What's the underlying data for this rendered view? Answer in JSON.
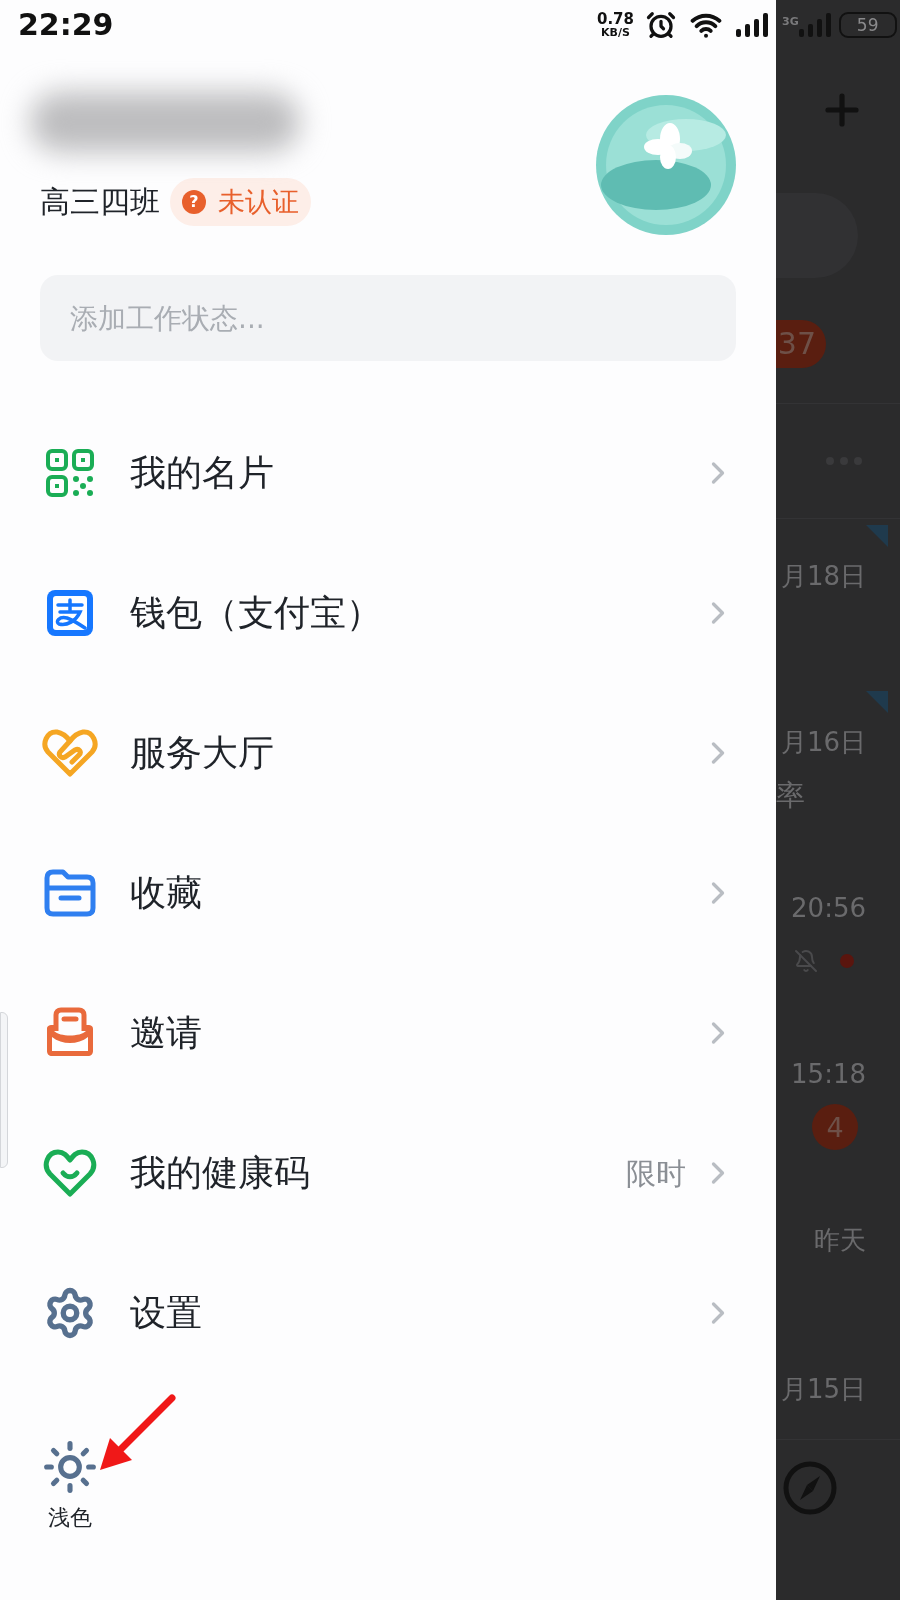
{
  "status_bar": {
    "time": "22:29",
    "net_speed": "0.78",
    "net_unit": "KB/S",
    "network": "3G",
    "battery": "59"
  },
  "profile": {
    "class_name": "高三四班",
    "badge_icon": "?",
    "badge": "未认证"
  },
  "status_field": {
    "placeholder": "添加工作状态..."
  },
  "menu": [
    {
      "kind": "qr",
      "label": "我的名片"
    },
    {
      "kind": "wallet",
      "label": "钱包（支付宝）"
    },
    {
      "kind": "service",
      "label": "服务大厅"
    },
    {
      "kind": "favorites",
      "label": "收藏"
    },
    {
      "kind": "invite",
      "label": "邀请"
    },
    {
      "kind": "health",
      "label": "我的健康码",
      "note": "限时"
    },
    {
      "kind": "settings",
      "label": "设置"
    }
  ],
  "theme_toggle": {
    "label": "浅色"
  },
  "background": {
    "unread_badge": "37",
    "rows": [
      {
        "time": "月18日",
        "flag": true
      },
      {
        "time": "月16日",
        "flag": true,
        "preview": "率"
      },
      {
        "time": "20:56",
        "flag": false,
        "muted": true,
        "dot": true
      },
      {
        "time": "15:18",
        "flag": false,
        "count": "4"
      },
      {
        "time": "昨天",
        "flag": false
      },
      {
        "time": "月15日",
        "flag": false
      }
    ]
  }
}
